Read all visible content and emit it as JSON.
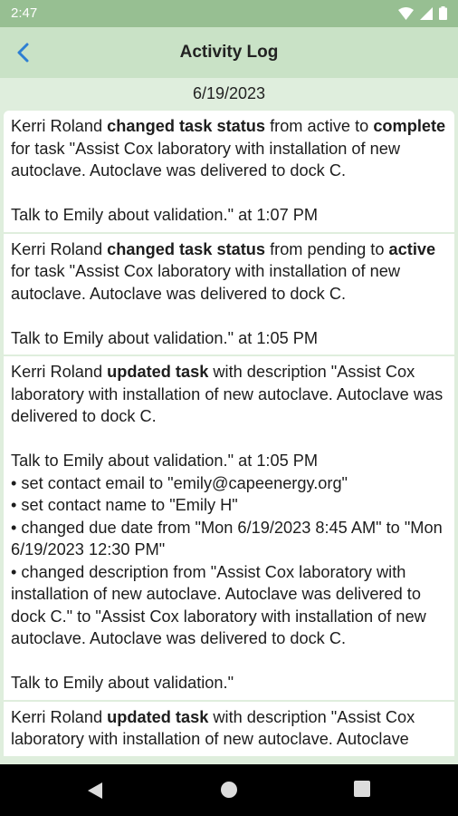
{
  "status_bar": {
    "time": "2:47"
  },
  "app_bar": {
    "title": "Activity Log"
  },
  "date_header": "6/19/2023",
  "entries": [
    {
      "actor": "Kerri Roland",
      "action": "changed task status",
      "middle": "from active to",
      "target_status": "complete",
      "rest": "for task \"Assist Cox laboratory with installation of new autoclave. Autoclave was delivered to dock C.\n\nTalk to Emily about validation.\" at 1:07 PM"
    },
    {
      "actor": "Kerri Roland",
      "action": "changed task status",
      "middle": "from pending to",
      "target_status": "active",
      "rest": "for task \"Assist Cox laboratory with installation of new autoclave. Autoclave was delivered to dock C.\n\nTalk to Emily about validation.\" at 1:05 PM"
    },
    {
      "actor": "Kerri Roland",
      "action": "updated task",
      "rest": "with description \"Assist Cox laboratory with installation of new autoclave. Autoclave was delivered to dock C.\n\nTalk to Emily about validation.\" at 1:05 PM",
      "changes": [
        "• set contact email to \"emily@capeenergy.org\"",
        "• set contact name to \"Emily H\"",
        "• changed due date from \"Mon 6/19/2023 8:45 AM\" to \"Mon 6/19/2023 12:30 PM\"",
        "• changed description from \"Assist Cox laboratory with installation of new autoclave. Autoclave was delivered to dock C.\" to \"Assist Cox laboratory with installation of new autoclave. Autoclave was delivered to dock C.\n\nTalk to Emily about validation.\""
      ]
    },
    {
      "actor": "Kerri Roland",
      "action": "updated task",
      "rest": "with description \"Assist Cox laboratory with installation of new autoclave. Autoclave"
    }
  ]
}
